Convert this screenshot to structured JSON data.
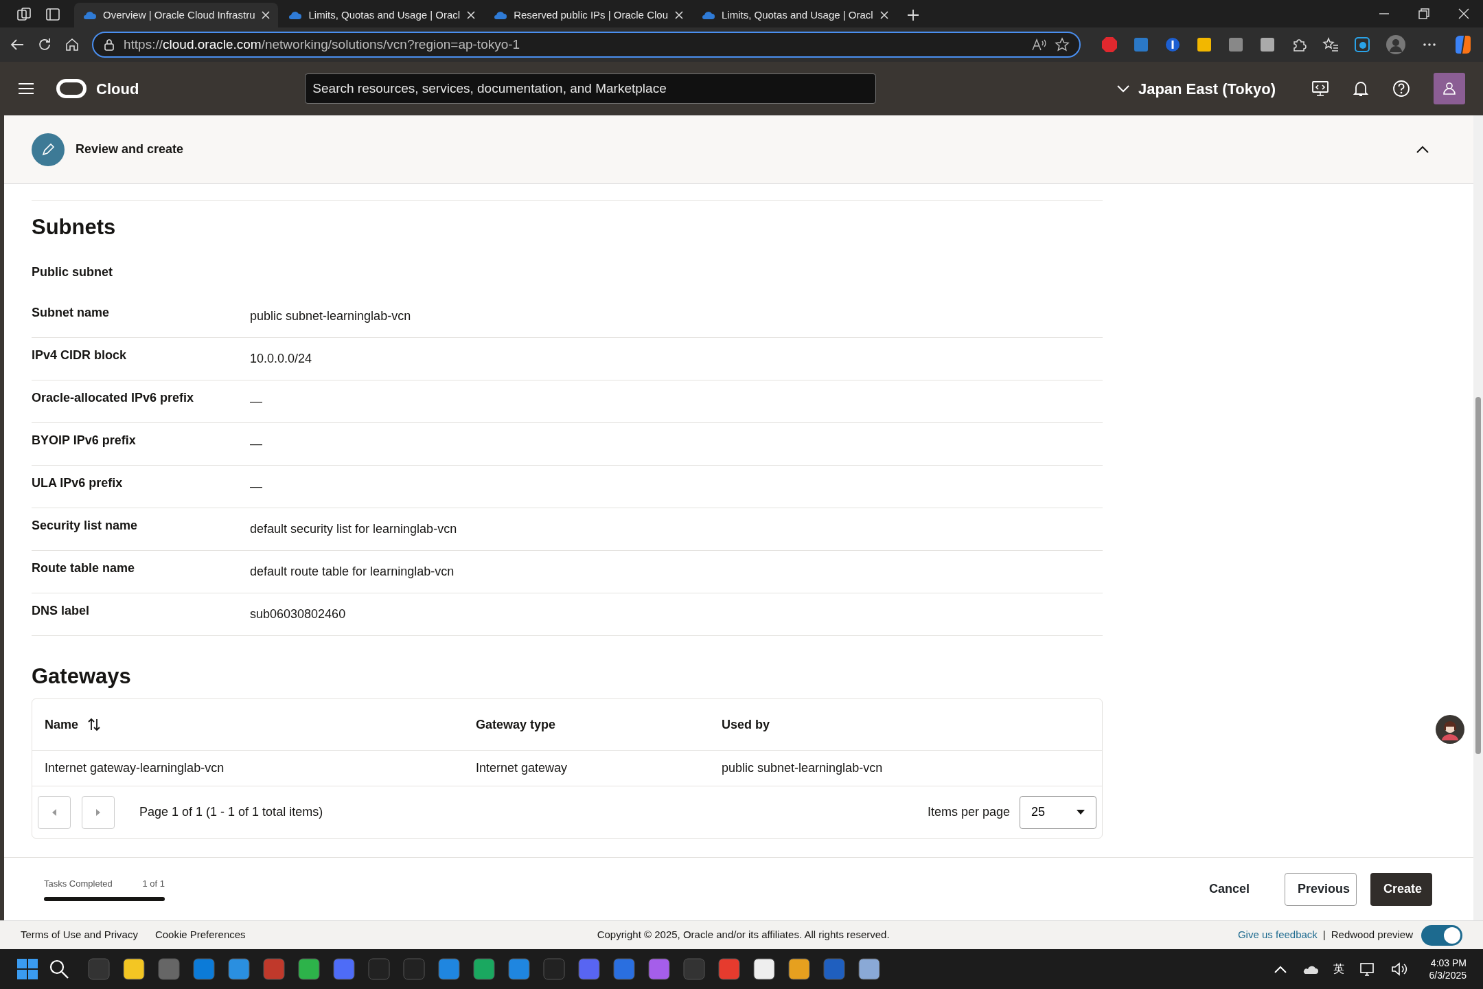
{
  "browser": {
    "tabs": [
      {
        "title": "Overview | Oracle Cloud Infrastru",
        "selected": true
      },
      {
        "title": "Limits, Quotas and Usage | Oracl",
        "selected": false
      },
      {
        "title": "Reserved public IPs | Oracle Clou",
        "selected": false
      },
      {
        "title": "Limits, Quotas and Usage | Oracl",
        "selected": false
      }
    ],
    "address": {
      "host": "cloud.oracle.com",
      "path": "/networking/solutions/vcn?region=ap-tokyo-1",
      "scheme": "https://"
    }
  },
  "header": {
    "product": "Cloud",
    "search": {
      "placeholder": "Search resources, services, documentation, and Marketplace"
    },
    "region": "Japan East (Tokyo)"
  },
  "step": {
    "title": "Review and create",
    "expanded": true
  },
  "subnets": {
    "heading": "Subnets",
    "subheading": "Public subnet",
    "rows": [
      {
        "label": "Subnet name",
        "value": "public subnet-learninglab-vcn"
      },
      {
        "label": "IPv4 CIDR block",
        "value": "10.0.0.0/24"
      },
      {
        "label": "Oracle-allocated IPv6 prefix",
        "value": "—"
      },
      {
        "label": "BYOIP IPv6 prefix",
        "value": "—"
      },
      {
        "label": "ULA IPv6 prefix",
        "value": "—"
      },
      {
        "label": "Security list name",
        "value": "default security list for learninglab-vcn"
      },
      {
        "label": "Route table name",
        "value": "default route table for learninglab-vcn"
      },
      {
        "label": "DNS label",
        "value": "sub06030802460"
      }
    ]
  },
  "gateways": {
    "heading": "Gateways",
    "table": {
      "columns": [
        "Name",
        "Gateway type",
        "Used by"
      ],
      "rows": [
        [
          "Internet gateway-learninglab-vcn",
          "Internet gateway",
          "public subnet-learninglab-vcn"
        ]
      ]
    },
    "pagination": {
      "summary": "Page 1 of 1 (1 - 1 of 1 total items)",
      "items_label": "Items per page",
      "items_per_page": "25"
    }
  },
  "progress": {
    "label": "Tasks Completed",
    "count": "1 of 1",
    "level": 1
  },
  "actions": {
    "cancel": "Cancel",
    "previous": "Previous",
    "create": "Create"
  },
  "footer": {
    "links": [
      "Terms of Use and Privacy",
      "Cookie Preferences"
    ],
    "copyright": "Copyright © 2025, Oracle and/or its affiliates. All rights reserved.",
    "feedback": "Give us feedback",
    "separator": "|",
    "preview": {
      "label": "Redwood preview",
      "on": true
    }
  },
  "taskbar": {
    "ime": "英",
    "time": "4:03 PM",
    "date": "6/3/2025"
  }
}
